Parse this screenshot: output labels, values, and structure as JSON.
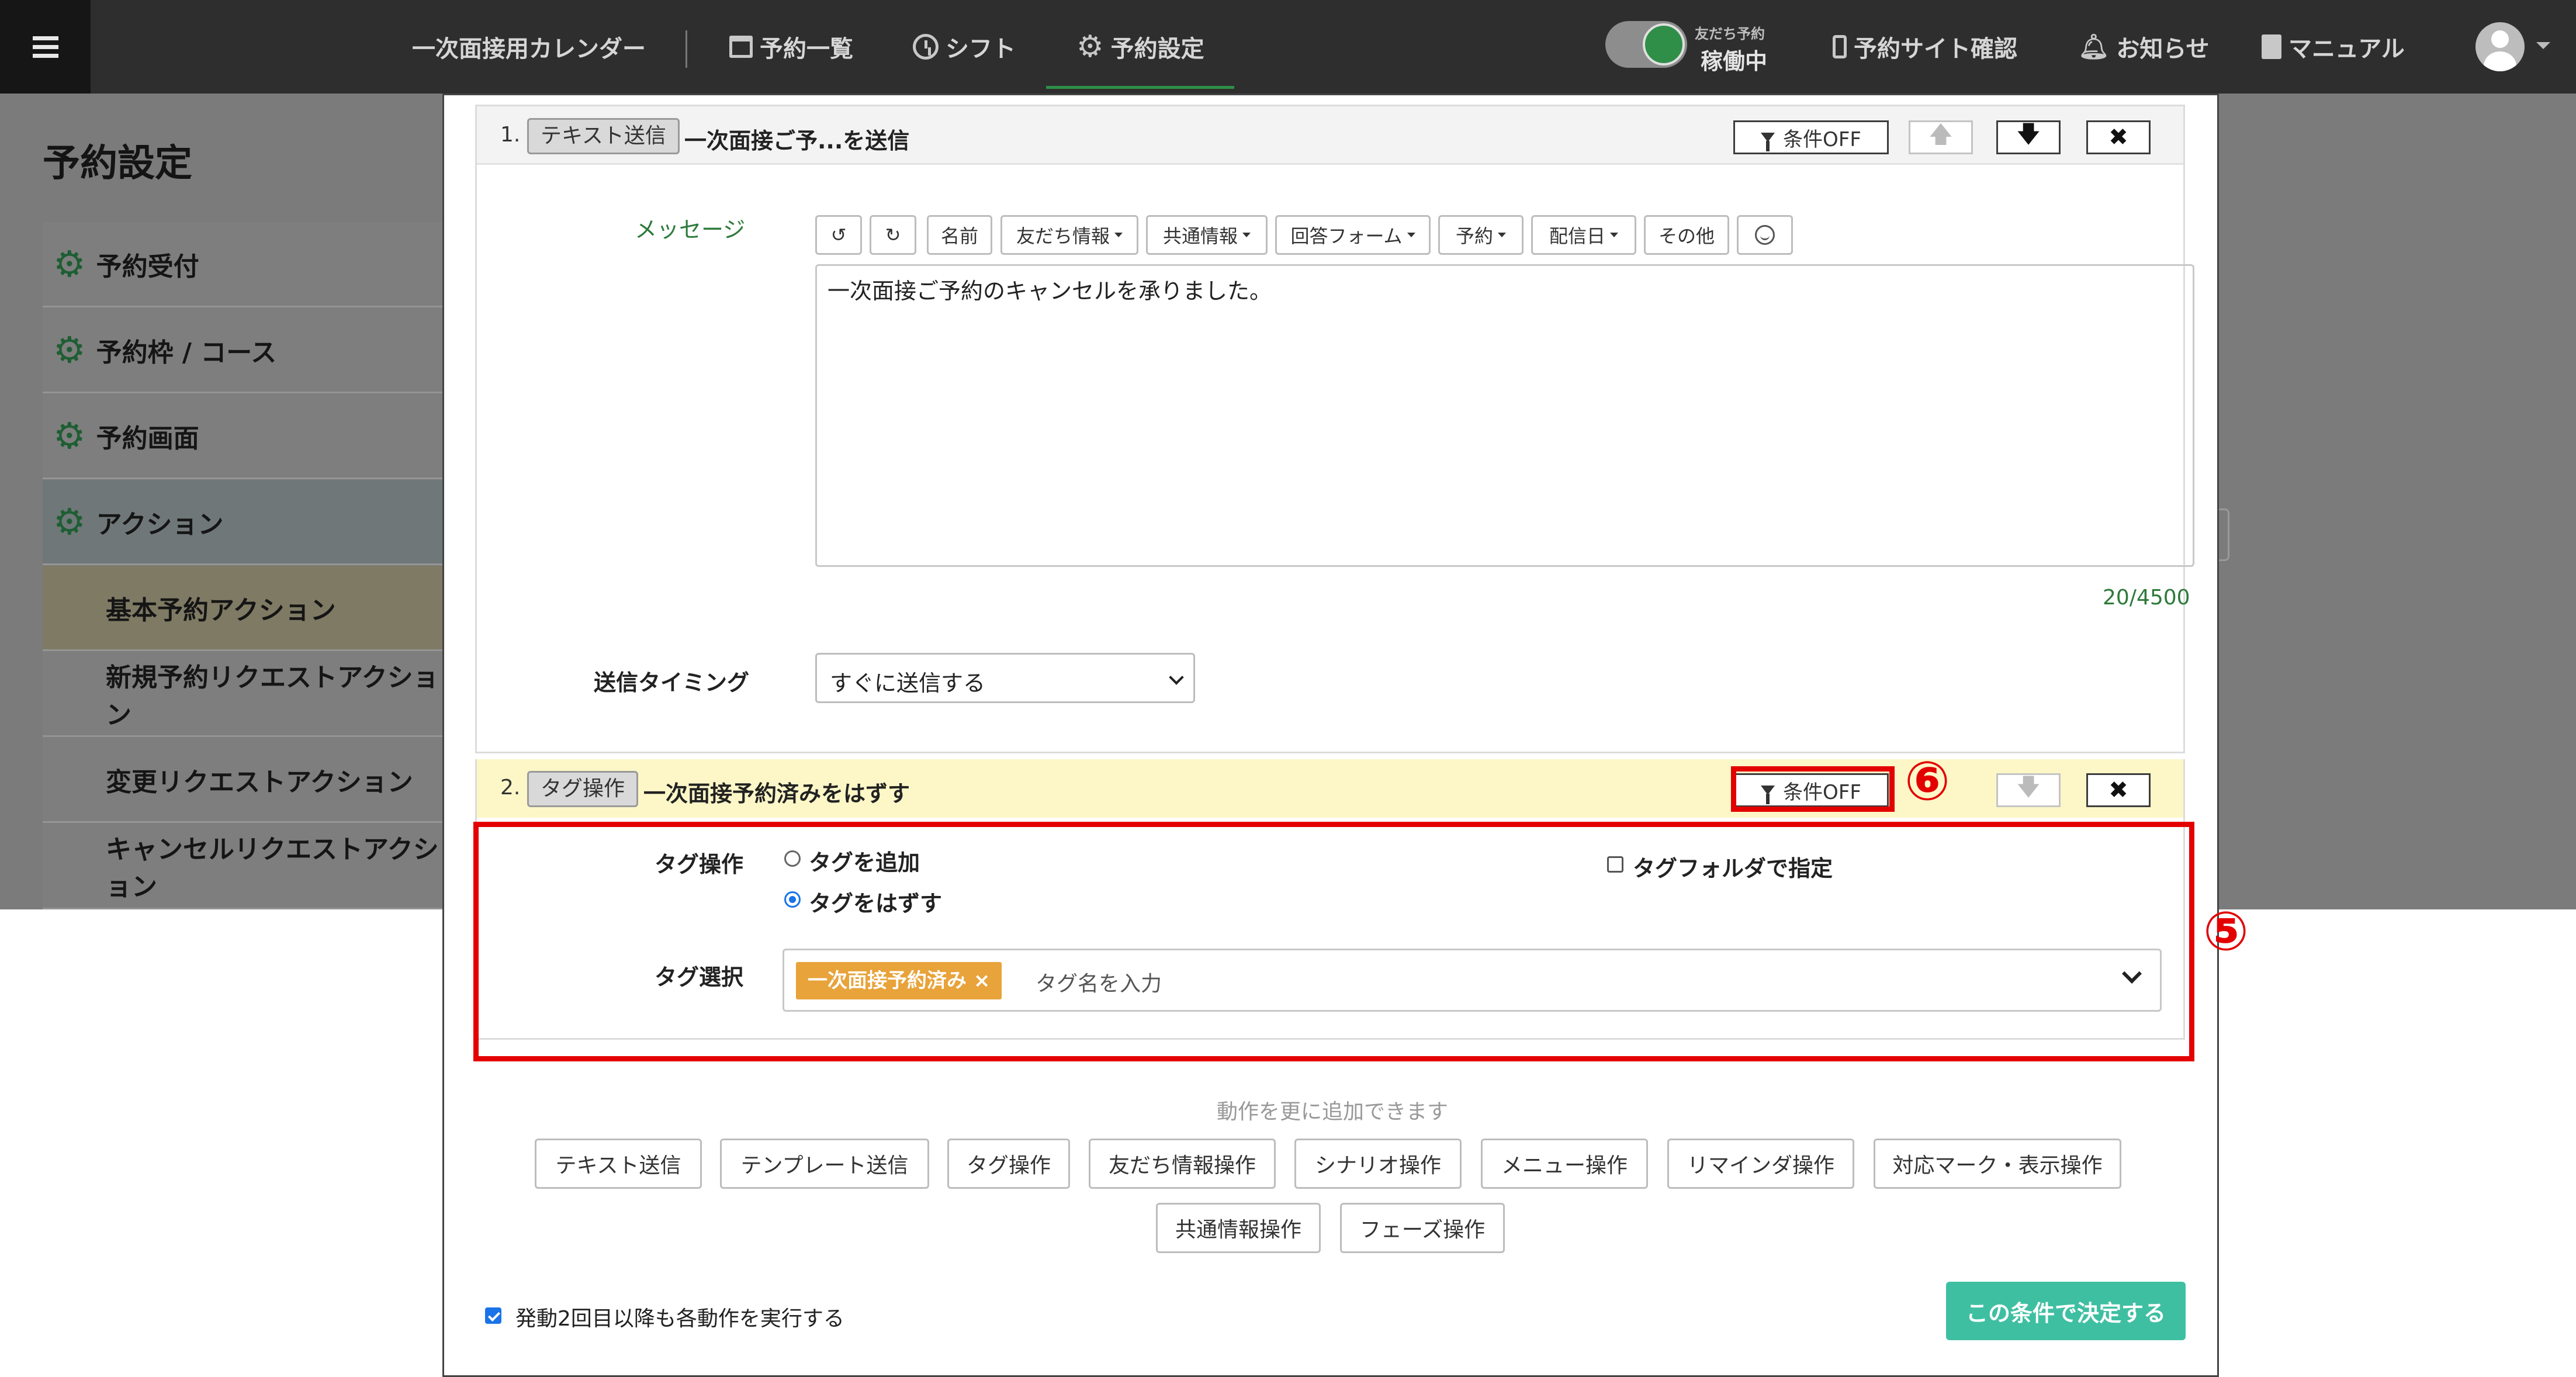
{
  "nav": {
    "app_title": "一次面接用カレンダー",
    "items": [
      {
        "label": "予約一覧",
        "icon": "calendar-icon"
      },
      {
        "label": "シフト",
        "icon": "clock-icon"
      },
      {
        "label": "予約設定",
        "icon": "gear-icon"
      }
    ],
    "toggle_caption": "友だち予約",
    "toggle_status": "稼働中",
    "right_items": [
      {
        "label": "予約サイト確認",
        "icon": "phone-icon"
      },
      {
        "label": "お知らせ",
        "icon": "bell-icon"
      },
      {
        "label": "マニュアル",
        "icon": "book-icon"
      }
    ]
  },
  "page": {
    "title": "予約設定"
  },
  "sidebar": {
    "items": [
      {
        "label": "予約受付"
      },
      {
        "label": "予約枠 / コース"
      },
      {
        "label": "予約画面"
      },
      {
        "label": "アクション"
      }
    ],
    "sub_items": [
      {
        "label": "基本予約アクション"
      },
      {
        "label": "新規予約リクエストアクション"
      },
      {
        "label": "変更リクエストアクション"
      },
      {
        "label": "キャンセルリクエストアクション"
      }
    ]
  },
  "action1": {
    "number": "1.",
    "type": "テキスト送信",
    "title": "一次面接ご予...を送信",
    "condition_label": "条件OFF",
    "message_label": "メッセージ",
    "toolbar": {
      "undo": "↺",
      "redo": "↻",
      "name": "名前",
      "friend_info": "友だち情報",
      "common_info": "共通情報",
      "answer_form": "回答フォーム",
      "reservation": "予約",
      "delivery_date": "配信日",
      "other": "その他"
    },
    "message_value": "一次面接ご予約のキャンセルを承りました。",
    "char_count": "20/4500",
    "timing_label": "送信タイミング",
    "timing_value": "すぐに送信する"
  },
  "action2": {
    "number": "2.",
    "type": "タグ操作",
    "title": "一次面接予約済みをはずす",
    "condition_label": "条件OFF",
    "tag_op_label": "タグ操作",
    "opt_add": "タグを追加",
    "opt_remove": "タグをはずす",
    "folder_label": "タグフォルダで指定",
    "tag_select_label": "タグ選択",
    "selected_tag": "一次面接予約済み ×",
    "tag_placeholder": "タグ名を入力"
  },
  "annotations": {
    "five": "⑤",
    "six": "⑥"
  },
  "footer": {
    "add_hint": "動作を更に追加できます",
    "actions": [
      "テキスト送信",
      "テンプレート送信",
      "タグ操作",
      "友だち情報操作",
      "シナリオ操作",
      "メニュー操作",
      "リマインダ操作",
      "対応マーク・表示操作",
      "共通情報操作",
      "フェーズ操作"
    ],
    "repeat_label": "発動2回目以降も各動作を実行する",
    "submit": "この条件で決定する"
  },
  "colors": {
    "accent_green": "#2f8f48",
    "submit_teal": "#3fbfa2",
    "highlight_red": "#e30000",
    "tag_orange": "#e8a33a"
  }
}
